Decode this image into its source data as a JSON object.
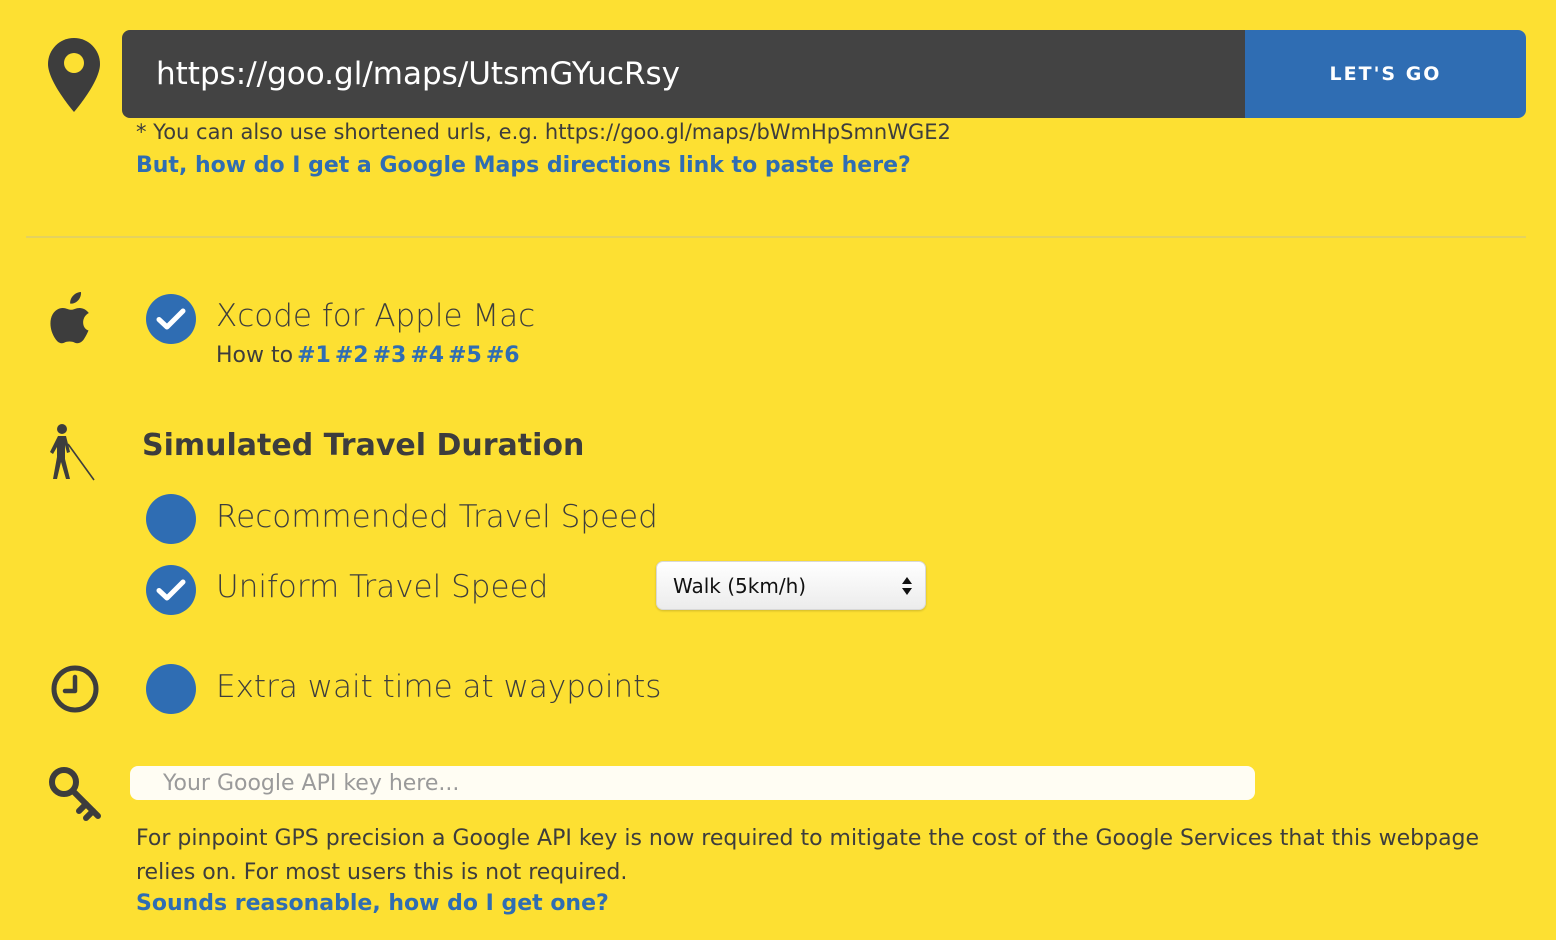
{
  "url_bar": {
    "value": "https://goo.gl/maps/UtsmGYucRsy",
    "button_label": "LET'S GO",
    "hint": "* You can also use shortened urls, e.g. https://goo.gl/maps/bWmHpSmnWGE2",
    "help_link": "But, how do I get a Google Maps directions link to paste here?"
  },
  "xcode": {
    "label": "Xcode for Apple Mac",
    "checked": true,
    "howto_prefix": "How to",
    "howto_links": [
      "#1",
      "#2",
      "#3",
      "#4",
      "#5",
      "#6"
    ]
  },
  "travel": {
    "title": "Simulated Travel Duration",
    "options": [
      {
        "label": "Recommended Travel Speed",
        "checked": false
      },
      {
        "label": "Uniform Travel Speed",
        "checked": true
      }
    ],
    "speed_select": {
      "selected": "Walk (5km/h)"
    }
  },
  "wait": {
    "label": "Extra wait time at waypoints",
    "checked": false
  },
  "api": {
    "placeholder": "Your Google API key here...",
    "note": "For pinpoint GPS precision a Google API key is now required to mitigate the cost of the Google Services that this webpage relies on. For most users this is not required.",
    "link": "Sounds reasonable, how do I get one?"
  },
  "colors": {
    "background": "#fde032",
    "accent": "#2f6db3",
    "input_dark": "#434343",
    "text": "#3d3d3d"
  },
  "icons": [
    "map-pin-icon",
    "apple-icon",
    "walker-icon",
    "clock-icon",
    "key-icon",
    "checkmark-icon"
  ]
}
